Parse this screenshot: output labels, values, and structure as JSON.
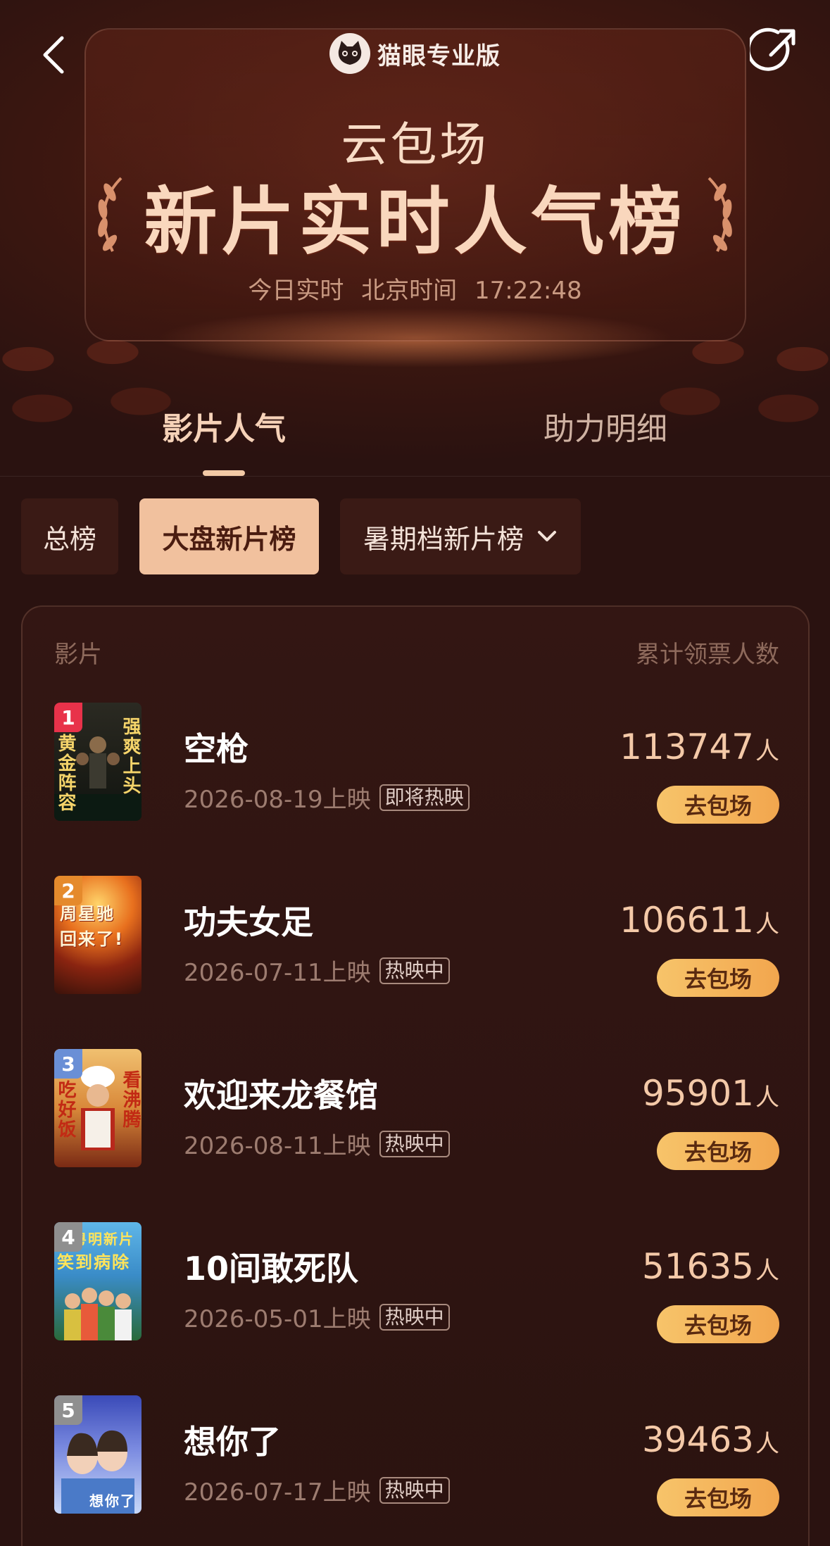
{
  "header": {
    "app_name": "猫眼专业版",
    "subtitle": "云包场",
    "title": "新片实时人气榜",
    "time_label": "今日实时",
    "timezone_label": "北京时间",
    "time_value": "17:22:48"
  },
  "tabs": [
    {
      "label": "影片人气",
      "active": true
    },
    {
      "label": "助力明细",
      "active": false
    }
  ],
  "filters": [
    {
      "label": "总榜",
      "active": false
    },
    {
      "label": "大盘新片榜",
      "active": true
    },
    {
      "label": "暑期档新片榜",
      "active": false
    }
  ],
  "table": {
    "col_movie": "影片",
    "col_count": "累计领票人数",
    "rows": [
      {
        "rank": "1",
        "title": "空枪",
        "date": "2026-08-19上映",
        "tag": "即将热映",
        "count": "113747",
        "unit": "人",
        "button": "去包场",
        "rank_color": "#e8324a"
      },
      {
        "rank": "2",
        "title": "功夫女足",
        "date": "2026-07-11上映",
        "tag": "热映中",
        "count": "106611",
        "unit": "人",
        "button": "去包场",
        "rank_color": "#e58a2c"
      },
      {
        "rank": "3",
        "title": "欢迎来龙餐馆",
        "date": "2026-08-11上映",
        "tag": "热映中",
        "count": "95901",
        "unit": "人",
        "button": "去包场",
        "rank_color": "#6a8fd6"
      },
      {
        "rank": "4",
        "title": "10间敢死队",
        "date": "2026-05-01上映",
        "tag": "热映中",
        "count": "51635",
        "unit": "人",
        "button": "去包场",
        "rank_color": "#8f8f8f"
      },
      {
        "rank": "5",
        "title": "想你了",
        "date": "2026-07-17上映",
        "tag": "热映中",
        "count": "39463",
        "unit": "人",
        "button": "去包场",
        "rank_color": "#8f8f8f"
      }
    ]
  },
  "posters": {
    "p1": [
      "黄金阵容",
      "强爽上头"
    ],
    "p2": [
      "周星驰",
      "回来了!"
    ],
    "p3": [
      "吃好饭",
      "看沸腾"
    ],
    "p4": [
      "潘粤明新片",
      "笑到病除"
    ],
    "p5": [
      "想你了"
    ]
  }
}
